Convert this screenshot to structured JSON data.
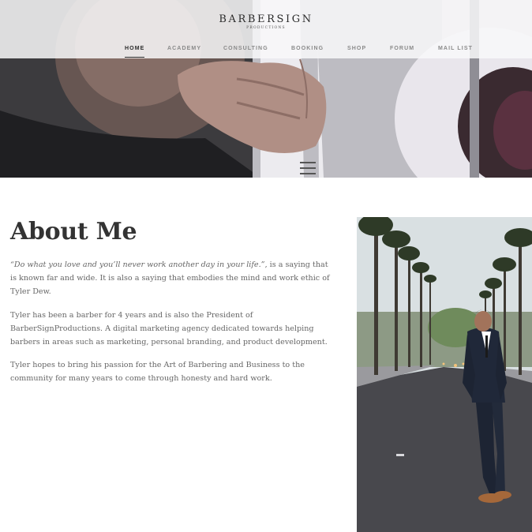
{
  "brand": {
    "name": "BARBERSIGN",
    "tagline": "PRODUCTIONS"
  },
  "nav": {
    "items": [
      {
        "label": "HOME",
        "active": true
      },
      {
        "label": "ACADEMY",
        "active": false
      },
      {
        "label": "CONSULTING",
        "active": false
      },
      {
        "label": "BOOKING",
        "active": false
      },
      {
        "label": "SHOP",
        "active": false
      },
      {
        "label": "FORUM",
        "active": false
      },
      {
        "label": "MAIL LIST",
        "active": false
      }
    ]
  },
  "hero": {
    "image_subject": "barber-holding-clipper-photo"
  },
  "about": {
    "title": "About Me",
    "p1_quote": "“Do what you love and you’ll never work another day in your life.”",
    "p1_rest": ", is a saying that is known far and wide. It is also a saying that embodies the mind and work ethic of Tyler Dew.",
    "p2": "Tyler has been a barber for 4 years and is also the President of BarberSignProductions. A digital marketing agency dedicated towards helping barbers in areas such as marketing, personal branding, and product development.",
    "p3": "Tyler hopes to bring his passion for the Art of Barbering and Business to the community for many years to come through honesty and hard work."
  },
  "portrait": {
    "image_subject": "man-in-suit-on-palm-lined-street-photo"
  },
  "colors": {
    "text_dark": "#333333",
    "text_body": "#666666",
    "nav_inactive": "#8a8a8a",
    "background": "#ffffff"
  }
}
